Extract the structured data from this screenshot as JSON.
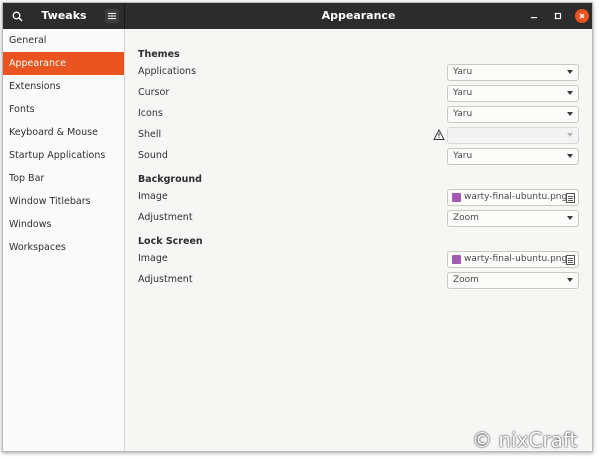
{
  "header": {
    "app_title": "Tweaks",
    "page_title": "Appearance"
  },
  "sidebar": {
    "items": [
      {
        "label": "General"
      },
      {
        "label": "Appearance",
        "active": true
      },
      {
        "label": "Extensions"
      },
      {
        "label": "Fonts"
      },
      {
        "label": "Keyboard & Mouse"
      },
      {
        "label": "Startup Applications"
      },
      {
        "label": "Top Bar"
      },
      {
        "label": "Window Titlebars"
      },
      {
        "label": "Windows"
      },
      {
        "label": "Workspaces"
      }
    ]
  },
  "themes": {
    "title": "Themes",
    "applications": {
      "label": "Applications",
      "value": "Yaru"
    },
    "cursor": {
      "label": "Cursor",
      "value": "Yaru"
    },
    "icons": {
      "label": "Icons",
      "value": "Yaru"
    },
    "shell": {
      "label": "Shell",
      "value": ""
    },
    "sound": {
      "label": "Sound",
      "value": "Yaru"
    }
  },
  "background": {
    "title": "Background",
    "image": {
      "label": "Image",
      "value": "warty-final-ubuntu.png"
    },
    "adjustment": {
      "label": "Adjustment",
      "value": "Zoom"
    }
  },
  "lock_screen": {
    "title": "Lock Screen",
    "image": {
      "label": "Image",
      "value": "warty-final-ubuntu.png"
    },
    "adjustment": {
      "label": "Adjustment",
      "value": "Zoom"
    }
  },
  "watermark": "© nixCraft",
  "colors": {
    "accent": "#e95420",
    "headerbar": "#2c2c2c"
  }
}
